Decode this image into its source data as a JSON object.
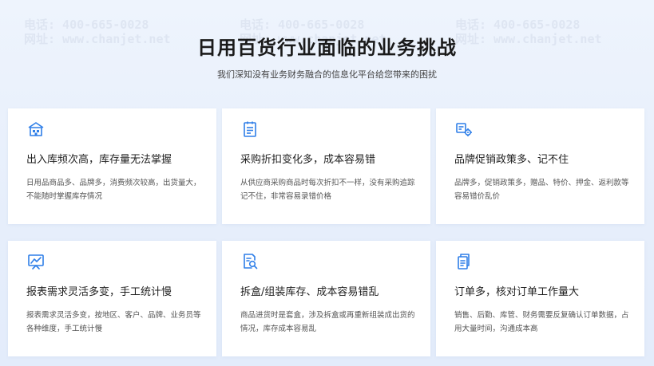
{
  "header": {
    "title": "日用百货行业面临的业务挑战",
    "subtitle": "我们深知没有业务财务融合的信息化平台给您带来的困扰"
  },
  "cards": [
    {
      "icon": "warehouse-icon",
      "title": "出入库频次高，库存量无法掌握",
      "desc": "日用品商品多、品牌多，消费频次较高，出货量大，不能随时掌握库存情况"
    },
    {
      "icon": "document-list-icon",
      "title": "采购折扣变化多，成本容易错",
      "desc": "从供应商采购商品时每次折扣不一样，没有采购追踪记不住，非常容易录错价格"
    },
    {
      "icon": "brand-gear-icon",
      "title": "品牌促销政策多、记不住",
      "desc": "品牌多，促销政策多，赠品、特价、押金、返利款等容易错价乱价"
    },
    {
      "icon": "chart-board-icon",
      "title": "报表需求灵活多变，手工统计慢",
      "desc": "报表需求灵活多变，按地区、客户、品牌、业务员等各种维度，手工统计慢"
    },
    {
      "icon": "search-doc-icon",
      "title": "拆盒/组装库存、成本容易错乱",
      "desc": "商品进货时是套盒，涉及拆盒或再重新组装成出货的情况，库存成本容易乱"
    },
    {
      "icon": "order-doc-icon",
      "title": "订单多，核对订单工作量大",
      "desc": "销售、后勤、库管、财务需要反复确认订单数据，占用大量时间，沟通成本高"
    }
  ],
  "watermark": {
    "phone": "电话: 400-665-0028",
    "site": "网址: www.chanjet.net"
  },
  "colors": {
    "accent": "#2f7fe8",
    "background": "#eaf1fc"
  }
}
